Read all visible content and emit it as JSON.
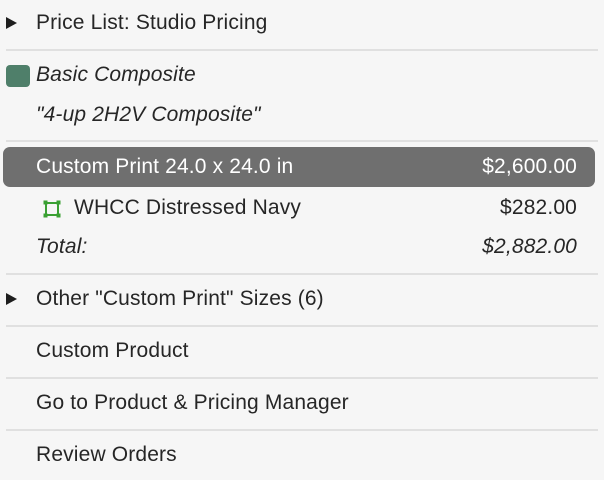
{
  "menu": {
    "price_list_label": "Price List: Studio Pricing",
    "composite_name": "Basic Composite",
    "composite_template": "\"4-up 2H2V Composite\"",
    "selected_item": {
      "label": "Custom Print 24.0 x 24.0 in",
      "price": "$2,600.00"
    },
    "addon_item": {
      "icon": "frame-icon",
      "label": "WHCC Distressed Navy",
      "price": "$282.00"
    },
    "total": {
      "label": "Total:",
      "price": "$2,882.00"
    },
    "other_sizes_label": "Other \"Custom Print\" Sizes (6)",
    "custom_product_label": "Custom Product",
    "pricing_manager_label": "Go to Product & Pricing Manager",
    "review_orders_label": "Review Orders"
  },
  "colors": {
    "highlight": "#6f6f6f",
    "swatch": "#4f7f6a",
    "frame_icon": "#3aa033"
  }
}
